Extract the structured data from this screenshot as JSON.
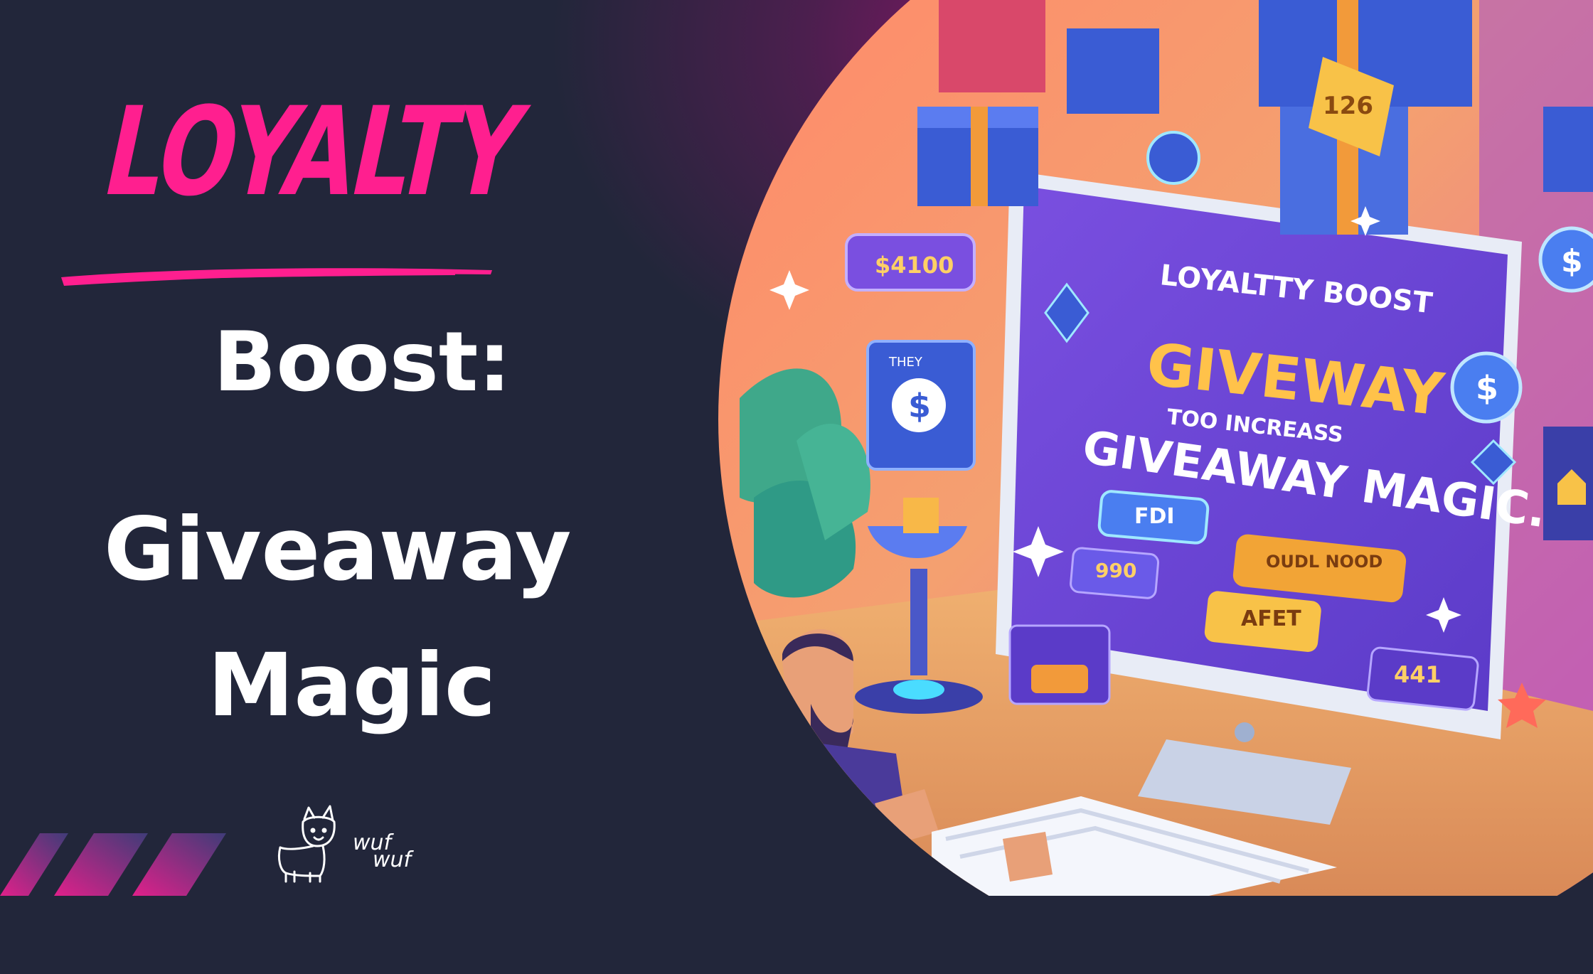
{
  "heading": {
    "word1": "LOYALTY",
    "word2": "Boost:",
    "word3": "Giveaway",
    "word4": "Magic"
  },
  "logo": {
    "line1": "wuf",
    "line2": "wuf",
    "icon": "dog-icon"
  },
  "illustration": {
    "screen_line1": "LOYALTTY BOOST",
    "screen_line2": "GIVEWAY",
    "screen_line3": "TOO INCREASS",
    "screen_line4": "GIVEAWAY MAGIC.",
    "btn_fdi": "FDI",
    "btn_990": "990",
    "btn_oudl": "OUDL NOOD",
    "btn_afet": "AFET",
    "btn_441": "441",
    "tag_4100": "$4100",
    "tag_126": "126",
    "card_they": "THEY",
    "dollar": "$"
  },
  "colors": {
    "background": "#22263a",
    "accent_pink": "#ff1f8f",
    "text_white": "#ffffff",
    "screen_purple": "#6a45d8",
    "gift_blue": "#3a5cd4",
    "ribbon_orange": "#f29a3a"
  }
}
